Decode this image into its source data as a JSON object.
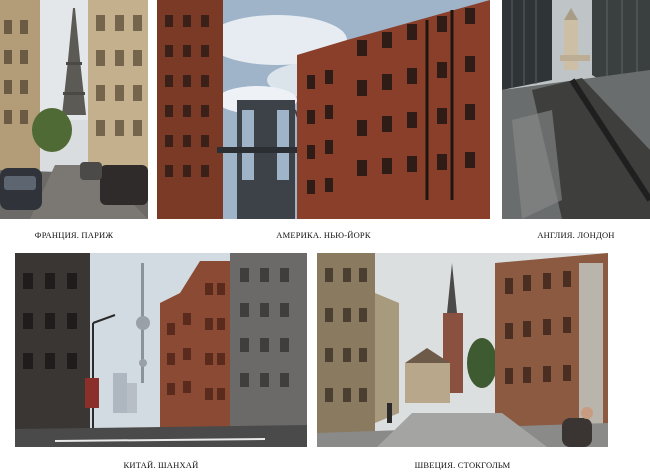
{
  "captions": {
    "paris": "ФРАНЦИЯ. ПАРИЖ",
    "newyork": "АМЕРИКА. НЬЮ-ЙОРК",
    "london": "АНГЛИЯ. ЛОНДОН",
    "shanghai": "КИТАЙ. ШАНХАЙ",
    "stockholm": "ШВЕЦИЯ. СТОКГОЛЬМ"
  },
  "colors": {
    "background": "#ffffff",
    "caption_text": "#111111",
    "brick": "#7a3a2a",
    "sky": "#c9d6e2"
  }
}
